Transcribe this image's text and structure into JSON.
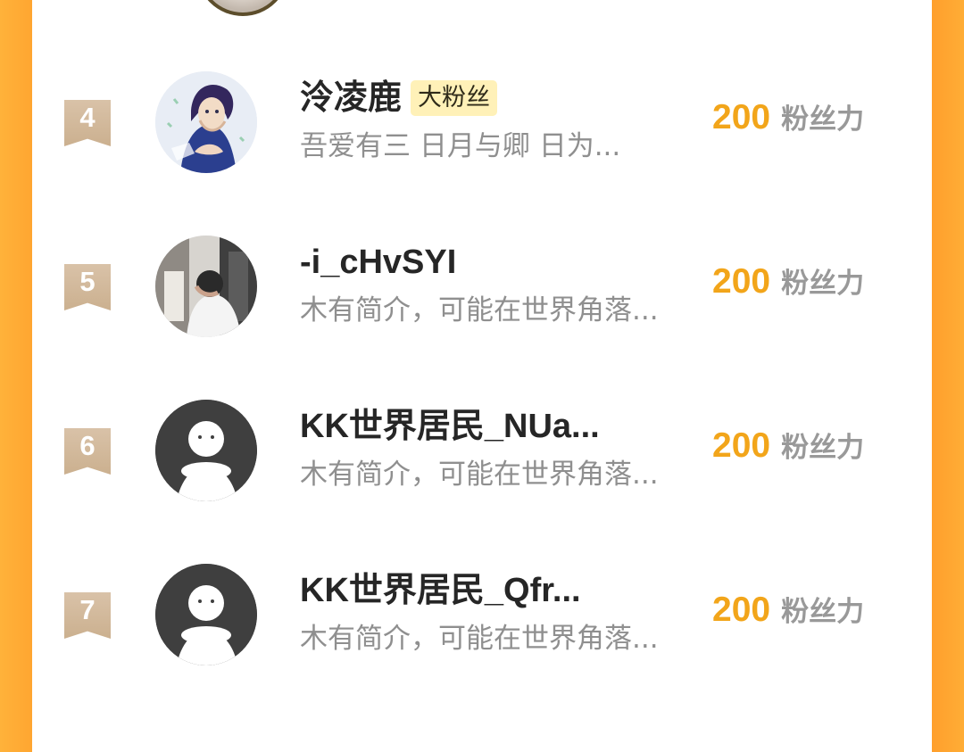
{
  "theme": {
    "accent": "#f2a51a",
    "border_orange": "#ffa631",
    "rank_badge_color": "#cbb08f",
    "fan_badge_color": "#fff1b8",
    "name_color": "#262626",
    "muted_text": "#999999"
  },
  "ranking": {
    "entries": [
      {
        "rank": "4",
        "username": "泠凌鹿",
        "badge": "大粉丝",
        "bio": "吾爱有三 日月与卿 日为...",
        "score": "200",
        "unit": "粉丝力",
        "avatar_icon": "anime-character-avatar"
      },
      {
        "rank": "5",
        "username": "-i_cHvSYI",
        "badge": "",
        "bio": "木有简介，可能在世界角落...",
        "score": "200",
        "unit": "粉丝力",
        "avatar_icon": "photo-person-avatar"
      },
      {
        "rank": "6",
        "username": "KK世界居民_NUa...",
        "badge": "",
        "bio": "木有简介，可能在世界角落...",
        "score": "200",
        "unit": "粉丝力",
        "avatar_icon": "default-avatar-icon"
      },
      {
        "rank": "7",
        "username": "KK世界居民_Qfr...",
        "badge": "",
        "bio": "木有简介，可能在世界角落...",
        "score": "200",
        "unit": "粉丝力",
        "avatar_icon": "default-avatar-icon"
      }
    ]
  }
}
